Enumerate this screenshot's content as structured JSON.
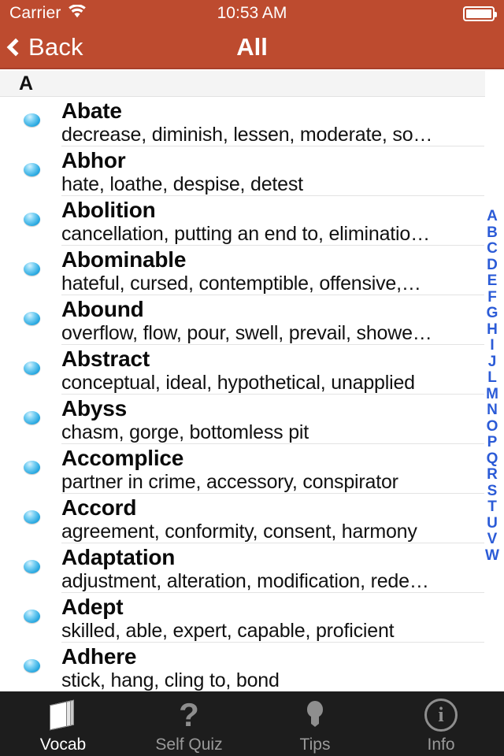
{
  "status_bar": {
    "carrier": "Carrier",
    "wifi_icon": "wifi-icon",
    "time": "10:53 AM",
    "battery_icon": "battery-full-icon",
    "battery_level": 100
  },
  "nav_bar": {
    "back_label": "Back",
    "back_icon": "chevron-left-icon",
    "title": "All",
    "background_color": "#bd4b2f"
  },
  "section": {
    "header": "A"
  },
  "list": {
    "bullet_icon": "blue-sphere-bullet-icon",
    "rows": [
      {
        "word": "Abate",
        "definition": "decrease, diminish, lessen, moderate, so…"
      },
      {
        "word": "Abhor",
        "definition": "hate, loathe, despise, detest"
      },
      {
        "word": "Abolition",
        "definition": "cancellation, putting an end to, eliminatio…"
      },
      {
        "word": "Abominable",
        "definition": "hateful, cursed, contemptible, offensive,…"
      },
      {
        "word": "Abound",
        "definition": "overflow, flow, pour, swell, prevail, showe…"
      },
      {
        "word": "Abstract",
        "definition": "conceptual, ideal, hypothetical, unapplied"
      },
      {
        "word": "Abyss",
        "definition": "chasm, gorge, bottomless pit"
      },
      {
        "word": "Accomplice",
        "definition": "partner in crime, accessory, conspirator"
      },
      {
        "word": "Accord",
        "definition": "agreement, conformity, consent, harmony"
      },
      {
        "word": "Adaptation",
        "definition": "adjustment, alteration, modification, rede…"
      },
      {
        "word": "Adept",
        "definition": "skilled, able, expert, capable, proficient"
      },
      {
        "word": "Adhere",
        "definition": "stick, hang, cling to, bond"
      }
    ]
  },
  "index_strip": {
    "color": "#2b5bd7",
    "letters": [
      "A",
      "B",
      "C",
      "D",
      "E",
      "F",
      "G",
      "H",
      "I",
      "J",
      "L",
      "M",
      "N",
      "O",
      "P",
      "Q",
      "R",
      "S",
      "T",
      "U",
      "V",
      "W"
    ]
  },
  "tab_bar": {
    "background_color": "#1d1d1d",
    "tabs": [
      {
        "label": "Vocab",
        "icon": "book-icon",
        "active": true
      },
      {
        "label": "Self Quiz",
        "icon": "question-mark-icon",
        "active": false
      },
      {
        "label": "Tips",
        "icon": "lightbulb-icon",
        "active": false
      },
      {
        "label": "Info",
        "icon": "info-circle-icon",
        "active": false
      }
    ]
  }
}
